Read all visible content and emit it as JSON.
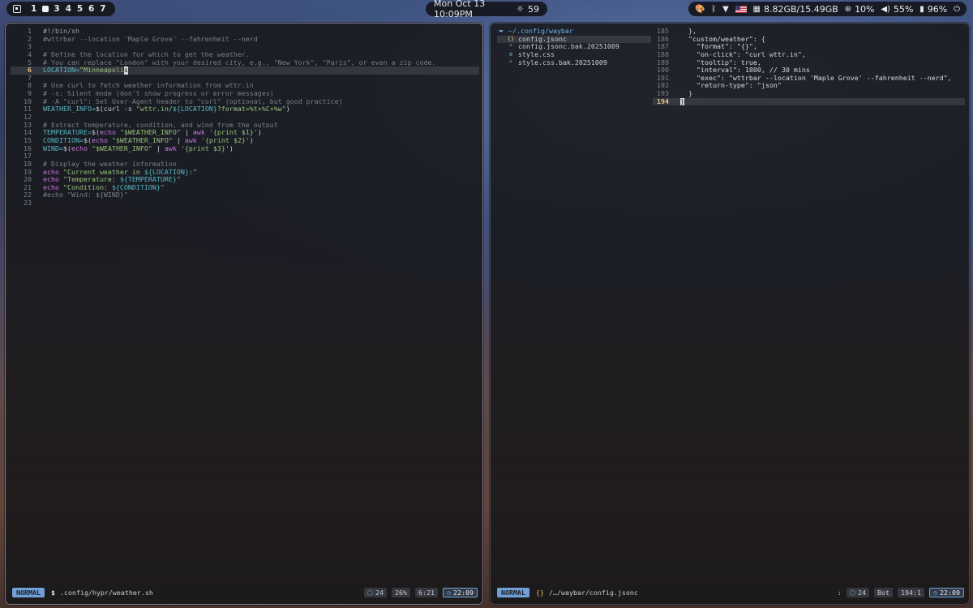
{
  "topbar": {
    "workspaces": [
      "1",
      "",
      "3",
      "4",
      "5",
      "6",
      "7"
    ],
    "clock": "Mon Oct 13 10:09PM",
    "weather": "59",
    "memory": "8.82GB/15.49GB",
    "cpu": "10%",
    "volume": "55%",
    "battery": "96%"
  },
  "left_editor": {
    "lines": [
      {
        "n": "1",
        "segs": [
          {
            "t": "#!/bin/sh",
            "c": "c-shebang"
          }
        ]
      },
      {
        "n": "2",
        "segs": [
          {
            "t": "#wttrbar --location 'Maple Grove' --fahrenheit --nerd",
            "c": "c-comment"
          }
        ]
      },
      {
        "n": "3",
        "segs": []
      },
      {
        "n": "4",
        "segs": [
          {
            "t": "# Define the location for which to get the weather.",
            "c": "c-comment"
          }
        ]
      },
      {
        "n": "5",
        "segs": [
          {
            "t": "# You can replace \"London\" with your desired city, e.g., \"New York\", \"Paris\", or even a zip code.",
            "c": "c-comment"
          }
        ]
      },
      {
        "n": "6",
        "cur": true,
        "segs": [
          {
            "t": "LOCATION=",
            "c": "c-var"
          },
          {
            "t": "\"Minneapoli",
            "c": "c-str"
          },
          {
            "t": "s",
            "c": "cursor"
          }
        ]
      },
      {
        "n": "7",
        "segs": []
      },
      {
        "n": "8",
        "segs": [
          {
            "t": "# Use curl to fetch weather information from wttr.in",
            "c": "c-comment"
          }
        ]
      },
      {
        "n": "9",
        "segs": [
          {
            "t": "# -s: Silent mode (don't show progress or error messages)",
            "c": "c-comment"
          }
        ]
      },
      {
        "n": "10",
        "segs": [
          {
            "t": "# -A \"curl\": Set User-Agent header to \"curl\" (optional, but good practice)",
            "c": "c-comment"
          }
        ]
      },
      {
        "n": "11",
        "segs": [
          {
            "t": "WEATHER_INFO=",
            "c": "c-var"
          },
          {
            "t": "$(curl -s ",
            "c": "c-plain"
          },
          {
            "t": "\"wttr.in/",
            "c": "c-str"
          },
          {
            "t": "${LOCATION}",
            "c": "c-var"
          },
          {
            "t": "?format=%t+%C+%w\"",
            "c": "c-str"
          },
          {
            "t": ")",
            "c": "c-plain"
          }
        ]
      },
      {
        "n": "12",
        "segs": []
      },
      {
        "n": "13",
        "segs": [
          {
            "t": "# Extract temperature, condition, and wind from the output",
            "c": "c-comment"
          }
        ]
      },
      {
        "n": "14",
        "segs": [
          {
            "t": "TEMPERATURE=",
            "c": "c-var"
          },
          {
            "t": "$(",
            "c": "c-plain"
          },
          {
            "t": "echo ",
            "c": "c-kw"
          },
          {
            "t": "\"$WEATHER_INFO\"",
            "c": "c-str"
          },
          {
            "t": " | ",
            "c": "c-plain"
          },
          {
            "t": "awk ",
            "c": "c-kw"
          },
          {
            "t": "'{print $1}'",
            "c": "c-str"
          },
          {
            "t": ")",
            "c": "c-plain"
          }
        ]
      },
      {
        "n": "15",
        "segs": [
          {
            "t": "CONDITION=",
            "c": "c-var"
          },
          {
            "t": "$(",
            "c": "c-plain"
          },
          {
            "t": "echo ",
            "c": "c-kw"
          },
          {
            "t": "\"$WEATHER_INFO\"",
            "c": "c-str"
          },
          {
            "t": " | ",
            "c": "c-plain"
          },
          {
            "t": "awk ",
            "c": "c-kw"
          },
          {
            "t": "'{print $2}'",
            "c": "c-str"
          },
          {
            "t": ")",
            "c": "c-plain"
          }
        ]
      },
      {
        "n": "16",
        "segs": [
          {
            "t": "WIND=",
            "c": "c-var"
          },
          {
            "t": "$(",
            "c": "c-plain"
          },
          {
            "t": "echo ",
            "c": "c-kw"
          },
          {
            "t": "\"$WEATHER_INFO\"",
            "c": "c-str"
          },
          {
            "t": " | ",
            "c": "c-plain"
          },
          {
            "t": "awk ",
            "c": "c-kw"
          },
          {
            "t": "'{print $3}'",
            "c": "c-str"
          },
          {
            "t": ")",
            "c": "c-plain"
          }
        ]
      },
      {
        "n": "17",
        "segs": []
      },
      {
        "n": "18",
        "segs": [
          {
            "t": "# Display the weather information",
            "c": "c-comment"
          }
        ]
      },
      {
        "n": "19",
        "segs": [
          {
            "t": "echo ",
            "c": "c-kw"
          },
          {
            "t": "\"Current weather in ",
            "c": "c-str"
          },
          {
            "t": "${LOCATION}",
            "c": "c-var"
          },
          {
            "t": ":\"",
            "c": "c-str"
          }
        ]
      },
      {
        "n": "20",
        "segs": [
          {
            "t": "echo ",
            "c": "c-kw"
          },
          {
            "t": "\"Temperature: ",
            "c": "c-str"
          },
          {
            "t": "${TEMPERATURE}",
            "c": "c-var"
          },
          {
            "t": "\"",
            "c": "c-str"
          }
        ]
      },
      {
        "n": "21",
        "segs": [
          {
            "t": "echo ",
            "c": "c-kw"
          },
          {
            "t": "\"Condition: ",
            "c": "c-str"
          },
          {
            "t": "${CONDITION}",
            "c": "c-var"
          },
          {
            "t": "\"",
            "c": "c-str"
          }
        ]
      },
      {
        "n": "22",
        "segs": [
          {
            "t": "#echo \"Wind: ${WIND}\"",
            "c": "c-comment"
          }
        ]
      },
      {
        "n": "23",
        "segs": []
      }
    ],
    "status": {
      "mode": "NORMAL",
      "prefix": "$",
      "path": ".config/hypr/weather.sh",
      "lsp": "24",
      "percent": "26%",
      "position": "6:21",
      "time": "22:09"
    }
  },
  "right_editor": {
    "tree": {
      "root": "~/.config/waybar",
      "files": [
        {
          "name": "config.jsonc",
          "icon": "{}",
          "kind": "json",
          "selected": true
        },
        {
          "name": "config.jsonc.bak.20251009",
          "icon": "*",
          "kind": "plain"
        },
        {
          "name": "style.css",
          "icon": "≡",
          "kind": "css"
        },
        {
          "name": "style.css.bak.20251009",
          "icon": "*",
          "kind": "plain"
        }
      ]
    },
    "lines": [
      {
        "n": "185",
        "segs": [
          {
            "t": "  },",
            "c": "c-plain"
          }
        ]
      },
      {
        "n": "186",
        "segs": [
          {
            "t": "  \"custom/weather\": {",
            "c": "c-key"
          }
        ]
      },
      {
        "n": "187",
        "segs": [
          {
            "t": "    \"format\": \"{}\",",
            "c": "c-key"
          }
        ]
      },
      {
        "n": "188",
        "segs": [
          {
            "t": "    \"on-click\": \"curl wttr.in\",",
            "c": "c-key"
          }
        ]
      },
      {
        "n": "189",
        "segs": [
          {
            "t": "    \"tooltip\": true,",
            "c": "c-key"
          }
        ]
      },
      {
        "n": "190",
        "segs": [
          {
            "t": "    \"interval\": 1800, // 30 mins",
            "c": "c-key"
          }
        ]
      },
      {
        "n": "191",
        "segs": [
          {
            "t": "    \"exec\": \"wttrbar --location 'Maple Grove' --fahrenheit --nerd\",",
            "c": "c-key"
          }
        ]
      },
      {
        "n": "192",
        "segs": [
          {
            "t": "    \"return-type\": \"json\"",
            "c": "c-key"
          }
        ]
      },
      {
        "n": "193",
        "segs": [
          {
            "t": "  }",
            "c": "c-plain"
          }
        ]
      },
      {
        "n": "194",
        "cur": true,
        "segs": [
          {
            "t": "}",
            "c": "cursor"
          }
        ]
      }
    ],
    "status": {
      "mode": "NORMAL",
      "prefix": "{}",
      "path": "/…/waybar/config.jsonc",
      "separator": ":",
      "lsp": "24",
      "percent": "Bot",
      "position": "194:1",
      "time": "22:09"
    }
  },
  "colors": {
    "mode": "#6fa0d8",
    "comment": "#7c7f88",
    "string": "#98c379",
    "variable": "#56b6c2",
    "keyword": "#c678dd"
  }
}
